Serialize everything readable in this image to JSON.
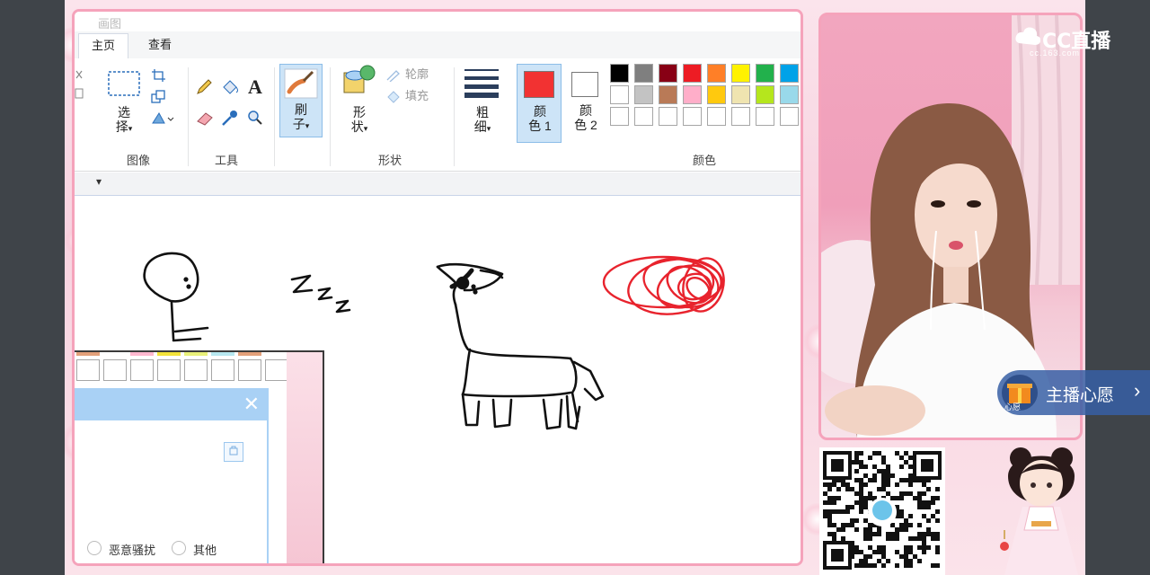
{
  "app": {
    "title": "画图"
  },
  "tabs": [
    {
      "label": "主页",
      "active": true
    },
    {
      "label": "查看",
      "active": false
    }
  ],
  "ribbon": {
    "groups": {
      "image": "图像",
      "tools": "工具",
      "shapes": "形状",
      "colors": "颜色"
    },
    "select": {
      "line1": "选",
      "line2": "择",
      "arrow": "▾"
    },
    "brush": {
      "line1": "刷",
      "line2": "子",
      "arrow": "▾"
    },
    "shapes": {
      "line1": "形",
      "line2": "状",
      "arrow": "▾"
    },
    "outline": "轮廓",
    "fill": "填充",
    "size": {
      "line1": "粗",
      "line2": "细",
      "arrow": "▾"
    },
    "color1": {
      "line1": "颜",
      "line2": "色 1"
    },
    "color2": {
      "line1": "颜",
      "line2": "色 2"
    },
    "text_tool": "A",
    "colors": {
      "primary": "#f23232",
      "secondary": "#ffffff",
      "row1": [
        "#000000",
        "#7f7f7f",
        "#880015",
        "#ed1c24",
        "#ff7f27",
        "#fff200",
        "#22b14c",
        "#00a2e8"
      ],
      "row2": [
        "#ffffff",
        "#c3c3c3",
        "#b97a57",
        "#ffaec9",
        "#ffc90e",
        "#efe4b0",
        "#b5e61d",
        "#99d9ea"
      ],
      "row3": [
        "#ffffff",
        "#ffffff",
        "#ffffff",
        "#ffffff",
        "#ffffff",
        "#ffffff",
        "#ffffff",
        "#ffffff"
      ]
    }
  },
  "qat": {
    "arrow": "▾"
  },
  "canvas": {
    "zzz": "Z z z",
    "ink": "#111111",
    "scribble_color": "#e8232d"
  },
  "overlay": {
    "close": "✕",
    "close_small": "✕",
    "options": [
      "恶意骚扰",
      "其他"
    ],
    "palette_strip": [
      "#e3a07a",
      "#ffffff",
      "#ffb8cf",
      "#f3e33a",
      "#e9f07a",
      "#b7e8f0"
    ]
  },
  "stream": {
    "logo": "CC直播",
    "logo_url": "cc.163.com",
    "wish_label": "主播心愿",
    "wish_sub": "心愿",
    "chevron": "›"
  }
}
